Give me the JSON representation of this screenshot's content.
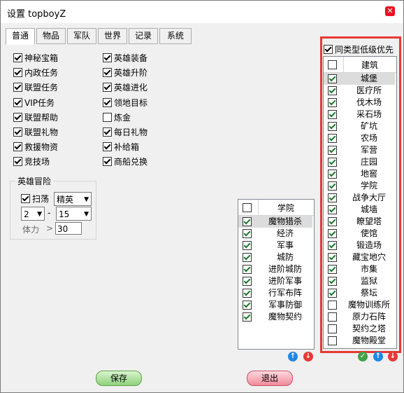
{
  "window": {
    "title": "设置 topboyZ",
    "close": "✕"
  },
  "tabs": [
    "普通",
    "物品",
    "军队",
    "世界",
    "记录",
    "系统"
  ],
  "left_checks": [
    {
      "label": "神秘宝箱",
      "checked": true
    },
    {
      "label": "内政任务",
      "checked": true
    },
    {
      "label": "联盟任务",
      "checked": true
    },
    {
      "label": "VIP任务",
      "checked": true
    },
    {
      "label": "联盟帮助",
      "checked": true
    },
    {
      "label": "联盟礼物",
      "checked": true
    },
    {
      "label": "救援物资",
      "checked": true
    },
    {
      "label": "竞技场",
      "checked": true
    }
  ],
  "right_checks": [
    {
      "label": "英雄装备",
      "checked": true
    },
    {
      "label": "英雄升阶",
      "checked": true
    },
    {
      "label": "英雄进化",
      "checked": true
    },
    {
      "label": "领地目标",
      "checked": true
    },
    {
      "label": "炼金",
      "checked": false
    },
    {
      "label": "每日礼物",
      "checked": true
    },
    {
      "label": "补给箱",
      "checked": true
    },
    {
      "label": "商船兑换",
      "checked": true
    }
  ],
  "hero_adventure": {
    "group_label": "英雄冒险",
    "sweep_label": "扫荡",
    "sweep_checked": true,
    "difficulty": "精英",
    "from": "2",
    "dash": "-",
    "to": "15",
    "stamina_label": "体力",
    "gt": ">",
    "stamina_value": "30"
  },
  "academy_list": {
    "header": "学院",
    "header_checked": true,
    "rows": [
      {
        "label": "魔物猎杀",
        "checked": true
      },
      {
        "label": "经济",
        "checked": true
      },
      {
        "label": "军事",
        "checked": true
      },
      {
        "label": "城防",
        "checked": true
      },
      {
        "label": "进阶城防",
        "checked": true
      },
      {
        "label": "进阶军事",
        "checked": true
      },
      {
        "label": "行军布阵",
        "checked": true
      },
      {
        "label": "军事防御",
        "checked": true
      },
      {
        "label": "魔物契约",
        "checked": true
      }
    ]
  },
  "building_panel": {
    "priority_label": "同类型低级优先",
    "priority_checked": true,
    "header": "建筑",
    "header_checked": false,
    "rows": [
      {
        "label": "城堡",
        "checked": true
      },
      {
        "label": "医疗所",
        "checked": true
      },
      {
        "label": "伐木场",
        "checked": true
      },
      {
        "label": "采石场",
        "checked": true
      },
      {
        "label": "矿坑",
        "checked": true
      },
      {
        "label": "农场",
        "checked": true
      },
      {
        "label": "军营",
        "checked": true
      },
      {
        "label": "庄园",
        "checked": true
      },
      {
        "label": "地窖",
        "checked": true
      },
      {
        "label": "学院",
        "checked": true
      },
      {
        "label": "战争大厅",
        "checked": true
      },
      {
        "label": "城墙",
        "checked": true
      },
      {
        "label": "瞭望塔",
        "checked": true
      },
      {
        "label": "使馆",
        "checked": true
      },
      {
        "label": "锻造场",
        "checked": true
      },
      {
        "label": "藏宝地穴",
        "checked": true
      },
      {
        "label": "市集",
        "checked": true
      },
      {
        "label": "监狱",
        "checked": true
      },
      {
        "label": "祭坛",
        "checked": true
      },
      {
        "label": "魔物训练所",
        "checked": false
      },
      {
        "label": "原力石阵",
        "checked": false
      },
      {
        "label": "契约之塔",
        "checked": false
      },
      {
        "label": "魔物殿堂",
        "checked": false
      }
    ]
  },
  "icons": {
    "up": "↑",
    "down": "↓",
    "ok": "✓"
  },
  "buttons": {
    "save": "保存",
    "exit": "退出"
  }
}
